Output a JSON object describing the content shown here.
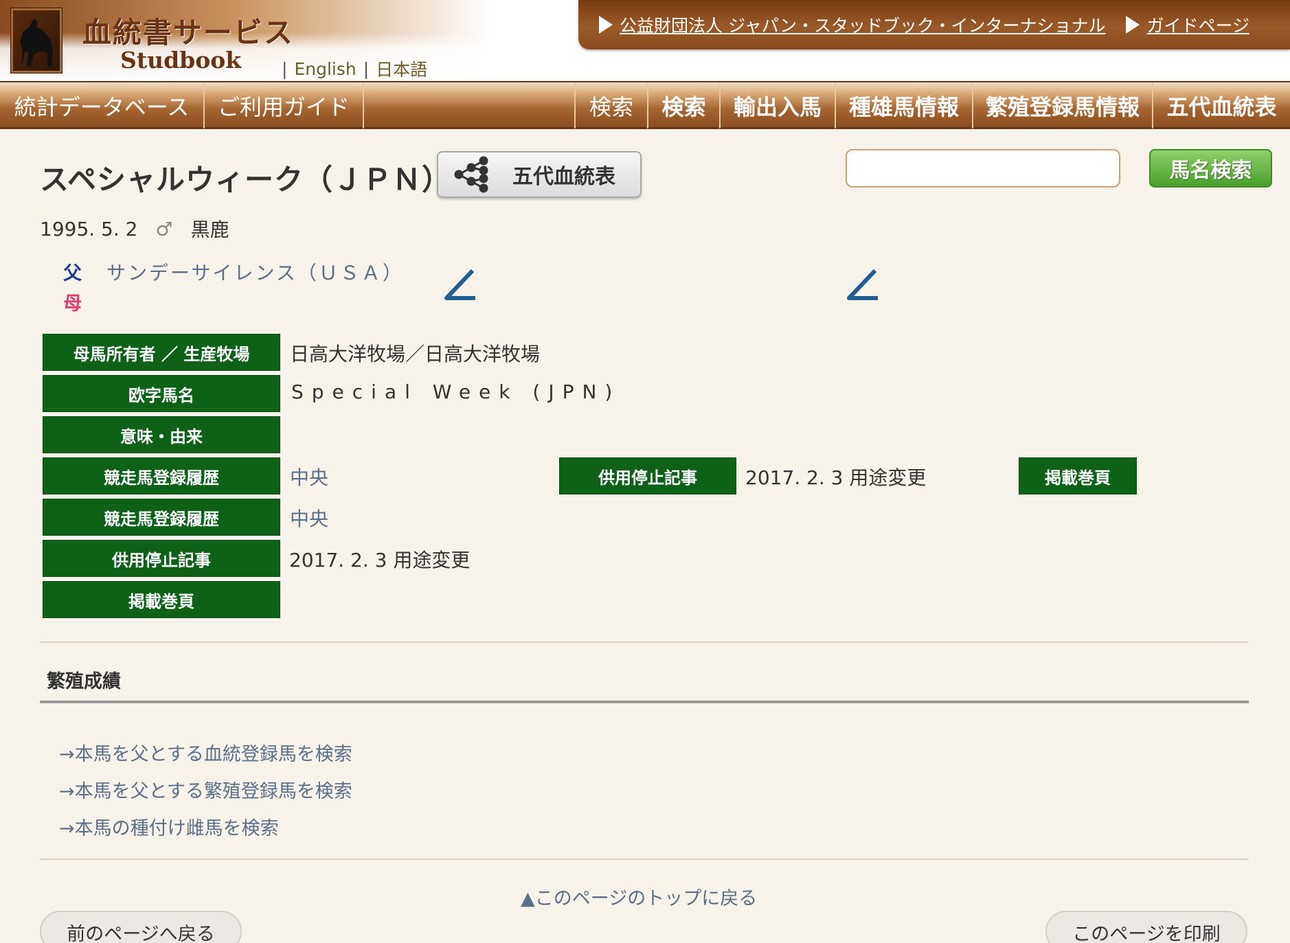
{
  "header": {
    "brand_title": "血統書サービス",
    "brand_sub": "Studbook",
    "lang_sep": "|",
    "lang_english": "English",
    "lang_japanese": "日本語",
    "top_links": [
      "公益財団法人 ジャパン・スタッドブック・インターナショナル",
      "ガイドページ"
    ]
  },
  "nav": {
    "left": [
      "統計データベース",
      "ご利用ガイド"
    ],
    "right": [
      "検索",
      "検索",
      "輸出入馬",
      "種雄馬情報",
      "繁殖登録馬情報",
      "五代血統表"
    ]
  },
  "horse": {
    "name": "スペシャルウィーク（ＪＰＮ）",
    "pedigree_button": "五代血統表",
    "birth": "1995. 5. 2",
    "sex_symbol": "♂",
    "color": "黒鹿",
    "sire_label": "父",
    "sire_name": "サンデーサイレンス（ＵＳＡ）",
    "dam_label": "母"
  },
  "search": {
    "value": "",
    "button": "馬名検索"
  },
  "info": {
    "owner_label": "母馬所有者 ／ 生産牧場",
    "owner_value": "日高大洋牧場／日高大洋牧場",
    "eng_label": "欧字馬名",
    "eng_value": "Special Week (JPN)",
    "meaning_label": "意味・由来",
    "race_label_1": "競走馬登録履歴",
    "race_value_1": "中央",
    "stop_label_inline": "供用停止記事",
    "stop_value_inline": "2017. 2. 3 用途変更",
    "vol_label_inline": "掲載巻頁",
    "race_label_2": "競走馬登録履歴",
    "race_value_2": "中央",
    "stop_label": "供用停止記事",
    "stop_value": "2017. 2. 3 用途変更",
    "vol_label": "掲載巻頁"
  },
  "breeding": {
    "title": "繁殖成績",
    "links": [
      "→本馬を父とする血統登録馬を検索",
      "→本馬を父とする繁殖登録馬を検索",
      "→本馬の種付け雌馬を検索"
    ]
  },
  "footer": {
    "back_to_top": "▲このページのトップに戻る",
    "prev_page": "前のページへ戻る",
    "print_page": "このページを印刷"
  },
  "colors": {
    "label_green": "#0d6218",
    "header_brown": "#8a4a1d",
    "link_blue_gray": "#5a6f88",
    "sire_blue": "#1a3b9a",
    "dam_pink": "#e23b6a"
  }
}
